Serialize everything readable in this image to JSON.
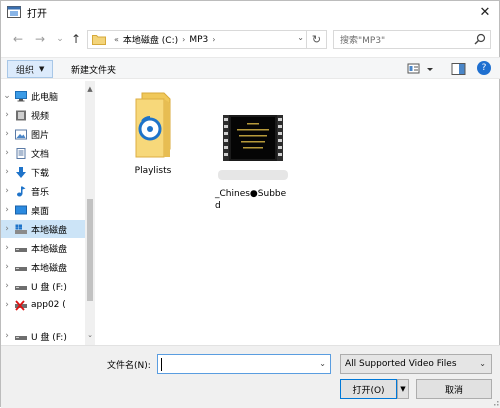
{
  "window": {
    "title": "打开",
    "close_glyph": "✕"
  },
  "nav": {
    "back_glyph": "←",
    "forward_glyph": "→",
    "recent_glyph": "⌄",
    "up_glyph": "↑"
  },
  "address": {
    "root_glyph": "«",
    "segments": [
      "本地磁盘 (C:)",
      "MP3"
    ],
    "sep_glyph": "›",
    "dropdown_glyph": "⌄",
    "refresh_glyph": "↻"
  },
  "search": {
    "placeholder": "搜索\"MP3\""
  },
  "toolbar": {
    "organize_label": "组织",
    "organize_arrow": "▼",
    "new_folder_label": "新建文件夹",
    "help_glyph": "?"
  },
  "sidebar": {
    "items": [
      {
        "label": "此电脑",
        "chevron": "⌄",
        "icon": "computer-icon"
      },
      {
        "label": "视频",
        "chevron": "›",
        "icon": "video-folder-icon"
      },
      {
        "label": "图片",
        "chevron": "›",
        "icon": "pictures-folder-icon"
      },
      {
        "label": "文档",
        "chevron": "›",
        "icon": "documents-folder-icon"
      },
      {
        "label": "下载",
        "chevron": "›",
        "icon": "download-icon"
      },
      {
        "label": "音乐",
        "chevron": "›",
        "icon": "music-icon"
      },
      {
        "label": "桌面",
        "chevron": "›",
        "icon": "desktop-icon"
      },
      {
        "label": "本地磁盘",
        "chevron": "›",
        "icon": "windows-drive-icon"
      },
      {
        "label": "本地磁盘",
        "chevron": "›",
        "icon": "drive-icon"
      },
      {
        "label": "本地磁盘",
        "chevron": "›",
        "icon": "drive-icon"
      },
      {
        "label": "U 盘 (F:)",
        "chevron": "›",
        "icon": "usb-drive-icon"
      },
      {
        "label": "app02 (",
        "chevron": "›",
        "icon": "network-drive-icon"
      },
      {
        "label": "U 盘 (F:)",
        "chevron": "›",
        "icon": "usb-drive-icon"
      }
    ],
    "scroll_up": "▲",
    "scroll_down": "⌄"
  },
  "files": [
    {
      "name": "Playlists",
      "icon": "playlist-folder-icon"
    },
    {
      "name": "_Chines●Subbed",
      "icon": "video-file-icon"
    }
  ],
  "bottom": {
    "filename_label": "文件名(N):",
    "filename_value": "",
    "filename_dropdown": "⌄",
    "filter_value": "All Supported Video Files",
    "filter_dropdown": "⌄",
    "open_label": "打开(O)",
    "open_dropdown": "▼",
    "cancel_label": "取消"
  },
  "colors": {
    "accent": "#0078d7",
    "selection": "#cce4f7"
  }
}
